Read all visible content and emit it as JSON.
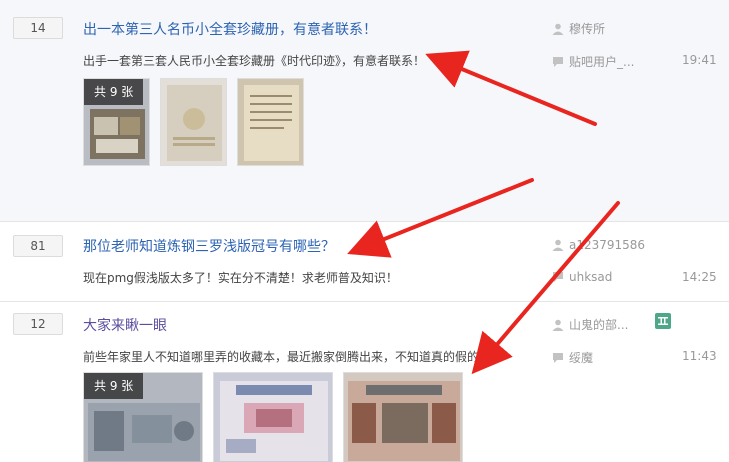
{
  "threads": [
    {
      "reply_count": "14",
      "title": "出一本第三人名币小全套珍藏册，有意者联系！",
      "abstract": "出手一套第三套人民币小全套珍藏册《时代印迹》，有意者联系！",
      "author": "穆传所",
      "last_reply_user": "贴吧用户_...",
      "time": "19:41",
      "image_count_badge": "共 9 张"
    },
    {
      "reply_count": "81",
      "title": "那位老师知道炼钢三罗浅版冠号有哪些？",
      "abstract": "现在pmg假浅版太多了！实在分不清楚！求老师普及知识！",
      "author": "a123791586",
      "last_reply_user": "uhksad",
      "time": "14:25"
    },
    {
      "reply_count": "12",
      "title": "大家来瞅一眼",
      "abstract": "前些年家里人不知道哪里弄的收藏本，最近搬家倒腾出来，不知道真的假的...",
      "author": "山鬼的部...",
      "last_reply_user": "绥魔",
      "time": "11:43",
      "image_count_badge": "共 9 张"
    }
  ],
  "colors": {
    "link": "#2d64b3",
    "visited_link": "#5c4d9e",
    "arrow": "#e8261f"
  },
  "icons": {
    "author": "person-icon",
    "last_reply": "speech-bubble-icon",
    "member_badge": "level-tag-icon"
  }
}
